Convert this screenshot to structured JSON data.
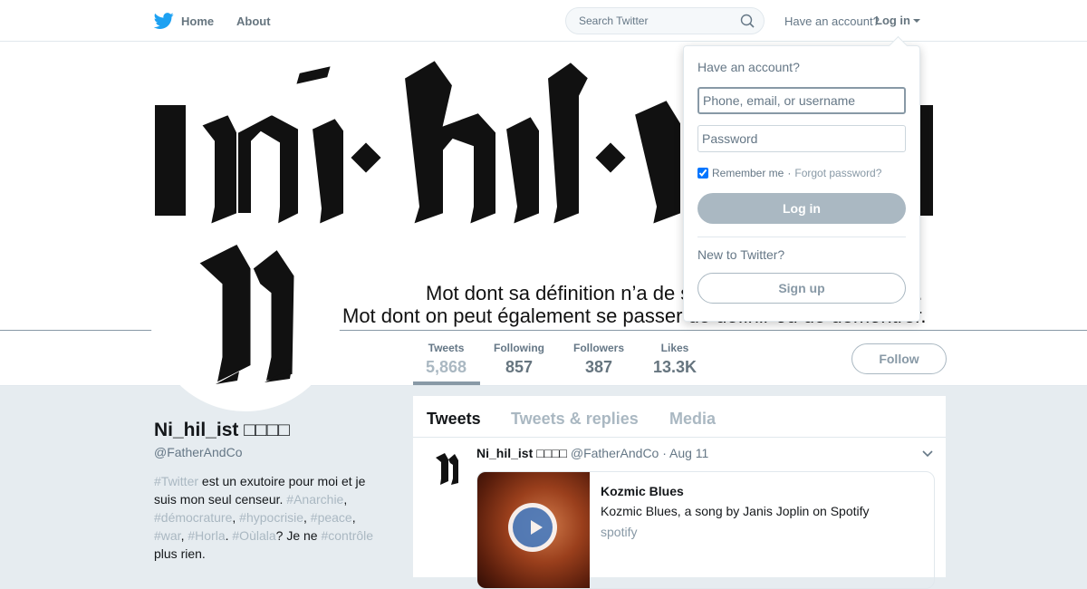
{
  "nav": {
    "home_label": "Home",
    "about_label": "About",
    "search_placeholder": "Search Twitter",
    "have_account": "Have an account?",
    "login_label": "Log in",
    "brand_color": "#1da1f2",
    "icons": [
      "twitter-bird-icon",
      "search-icon",
      "caret-down-icon"
    ]
  },
  "banner": {
    "line1": "Mot dont sa définition n’a de s",
    "line1_end": "e.",
    "line2": "Mot dont on peut également se passer de définir ou de démontrer."
  },
  "stats": [
    {
      "label": "Tweets",
      "value": "5,868"
    },
    {
      "label": "Following",
      "value": "857"
    },
    {
      "label": "Followers",
      "value": "387"
    },
    {
      "label": "Likes",
      "value": "13.3K"
    }
  ],
  "follow_label": "Follow",
  "profile": {
    "name": "Ni_hil_ist □□□□",
    "handle": "@FatherAndCo",
    "bio": [
      {
        "text": "#Twitter",
        "tag": true
      },
      {
        "text": " est un exutoire pour moi et je suis mon seul censeur. ",
        "tag": false
      },
      {
        "text": "#Anarchie",
        "tag": true
      },
      {
        "text": ", ",
        "tag": false
      },
      {
        "text": "#démocrature",
        "tag": true
      },
      {
        "text": ", ",
        "tag": false
      },
      {
        "text": "#hypocrisie",
        "tag": true
      },
      {
        "text": ", ",
        "tag": false
      },
      {
        "text": "#peace",
        "tag": true
      },
      {
        "text": ", ",
        "tag": false
      },
      {
        "text": "#war",
        "tag": true
      },
      {
        "text": ", ",
        "tag": false
      },
      {
        "text": "#Horla",
        "tag": true
      },
      {
        "text": ". ",
        "tag": false
      },
      {
        "text": "#Oùlala",
        "tag": true
      },
      {
        "text": "? Je ne ",
        "tag": false
      },
      {
        "text": "#contrôle",
        "tag": true
      },
      {
        "text": " plus rien.",
        "tag": false
      }
    ]
  },
  "timeline": {
    "tabs": [
      "Tweets",
      "Tweets & replies",
      "Media"
    ],
    "tweet": {
      "name": "Ni_hil_ist □□□□",
      "meta": "@FatherAndCo · Aug 11",
      "card": {
        "title": "Kozmic Blues",
        "description": "Kozmic Blues, a song by Janis Joplin on Spotify",
        "domain": "spotify"
      }
    }
  },
  "login_dropdown": {
    "title": "Have an account?",
    "username_placeholder": "Phone, email, or username",
    "password_placeholder": "Password",
    "remember_label": "Remember me",
    "separator": " · ",
    "forgot_label": "Forgot password?",
    "login_button": "Log in",
    "new_label": "New to Twitter?",
    "signup_button": "Sign up"
  }
}
